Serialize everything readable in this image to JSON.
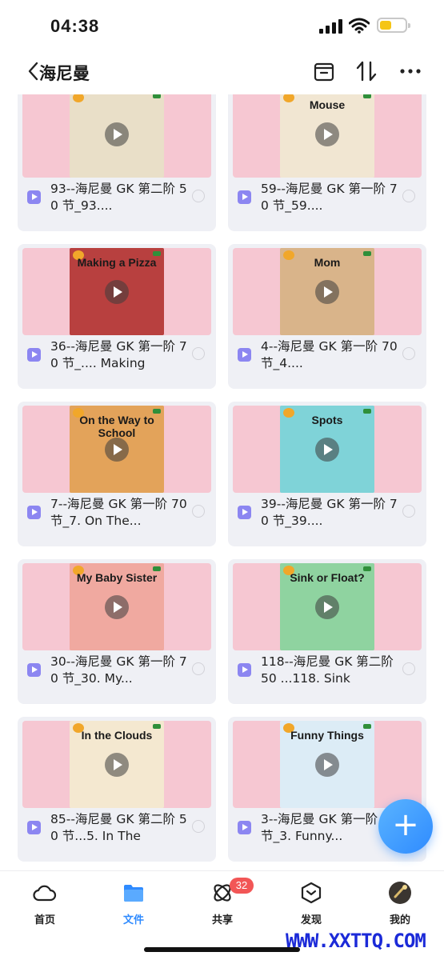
{
  "status": {
    "time": "04:38",
    "battery_level": 0.45,
    "battery_color": "#f5c516"
  },
  "navbar": {
    "title": "海尼曼",
    "back_icon": "chevron-left-icon",
    "actions": [
      "archive-box-icon",
      "sort-arrows-icon",
      "more-dots-icon"
    ]
  },
  "items": [
    {
      "title": "93--海尼曼 GK 第二阶 50 节_93....",
      "cover_title": "",
      "cover_bg": "#e9dfc8"
    },
    {
      "title": "59--海尼曼 GK 第一阶 70 节_59....",
      "cover_title": "Mouse",
      "cover_bg": "#f1e6d2"
    },
    {
      "title": "36--海尼曼 GK 第一阶 70 节_.... Making",
      "cover_title": "Making a Pizza",
      "cover_bg": "#b8403f"
    },
    {
      "title": "4--海尼曼 GK 第一阶 70 节_4....",
      "cover_title": "Mom",
      "cover_bg": "#d9b48a"
    },
    {
      "title": "7--海尼曼 GK 第一阶 70 节_7. On The...",
      "cover_title": "On the Way to School",
      "cover_bg": "#e3a35a"
    },
    {
      "title": "39--海尼曼 GK 第一阶 70 节_39....",
      "cover_title": "Spots",
      "cover_bg": "#7fd3d8"
    },
    {
      "title": "30--海尼曼 GK 第一阶 70 节_30. My...",
      "cover_title": "My Baby Sister",
      "cover_bg": "#f0a9a0"
    },
    {
      "title": "118--海尼曼 GK 第二阶 50 ...118. Sink",
      "cover_title": "Sink or Float?",
      "cover_bg": "#8fd3a0"
    },
    {
      "title": "85--海尼曼 GK 第二阶 50 节...5. In The",
      "cover_title": "In the Clouds",
      "cover_bg": "#f4e8d0"
    },
    {
      "title": "3--海尼曼 GK 第一阶 70 节_3. Funny...",
      "cover_title": "Funny Things",
      "cover_bg": "#dcecf6"
    }
  ],
  "fab": {
    "label": "+"
  },
  "tabs": [
    {
      "label": "首页",
      "icon": "cloud-home-icon",
      "active": false
    },
    {
      "label": "文件",
      "icon": "folder-icon",
      "active": true
    },
    {
      "label": "共享",
      "icon": "share-orbit-icon",
      "active": false,
      "badge": "32"
    },
    {
      "label": "发现",
      "icon": "discover-box-icon",
      "active": false
    },
    {
      "label": "我的",
      "icon": "avatar-icon",
      "active": false
    }
  ],
  "watermark": "WWW.XXTTQ.COM"
}
